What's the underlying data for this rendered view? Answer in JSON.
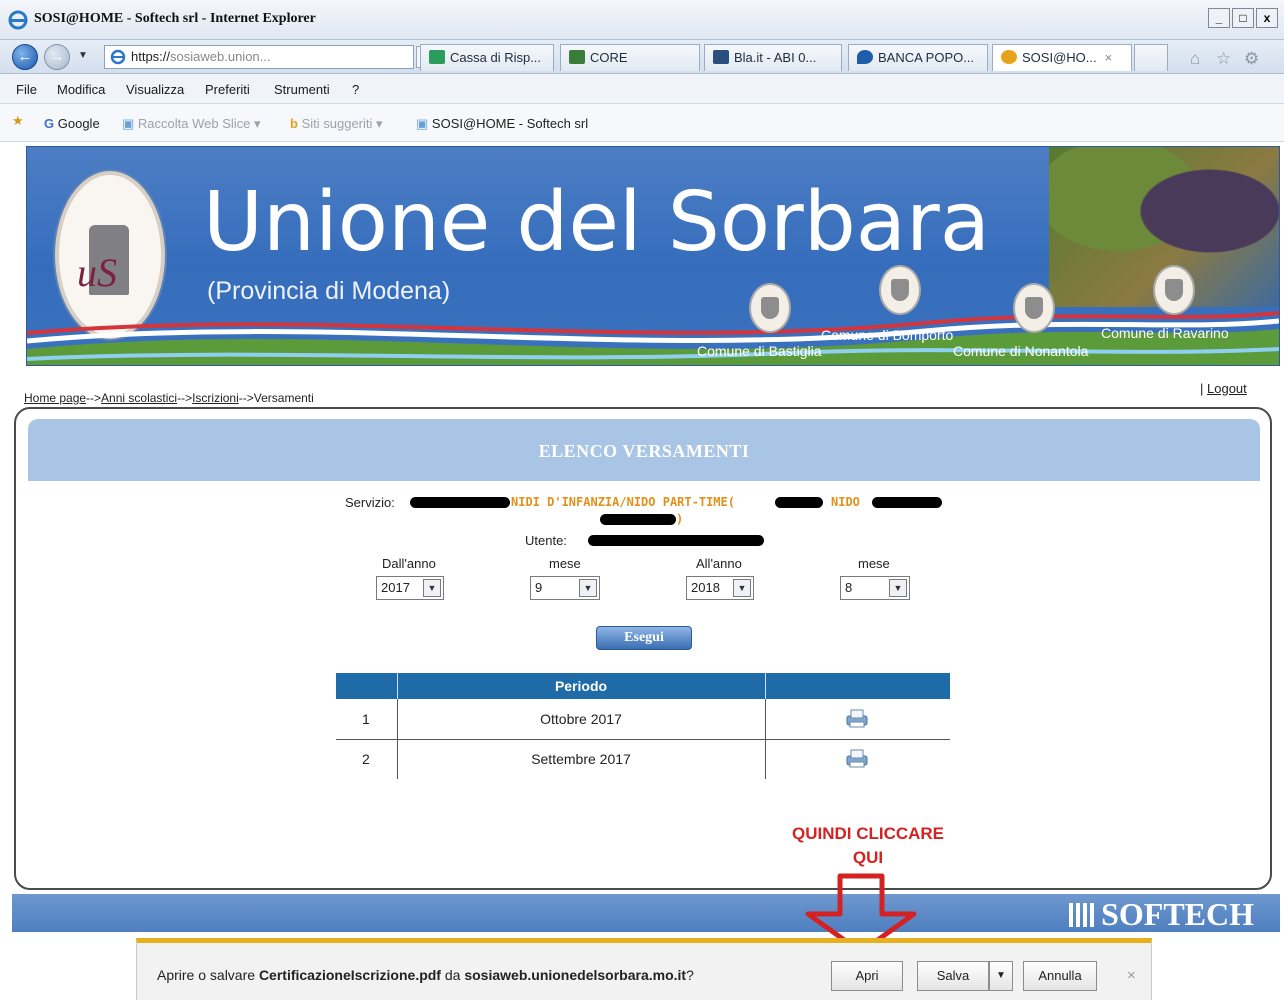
{
  "window": {
    "title": "SOSI@HOME - Softech srl - Internet Explorer",
    "controls": [
      "_",
      "□",
      "x"
    ]
  },
  "nav": {
    "address_host": "https://",
    "address_rest": "sosiaweb.union...",
    "tabs": [
      {
        "label": "Cassa di Risp...",
        "icon_color": "#2c9c5a"
      },
      {
        "label": "CORE",
        "icon_color": "#3a7d3a"
      },
      {
        "label": "Bla.it - ABI 0...",
        "icon_color": "#2a4f7f"
      },
      {
        "label": "BANCA POPO...",
        "icon_color": "#1e5da8"
      },
      {
        "label": "SOSI@HO...",
        "icon_color": "#e6a21a"
      }
    ],
    "tab_close": "×"
  },
  "menu": [
    "File",
    "Modifica",
    "Visualizza",
    "Preferiti",
    "Strumenti",
    "?"
  ],
  "favorites": {
    "google": "Google",
    "web_slice": "Raccolta Web Slice ▾",
    "suggested": "Siti suggeriti ▾",
    "page": "SOSI@HOME - Softech srl"
  },
  "banner": {
    "title": "Unione del Sorbara",
    "subtitle": "(Provincia di Modena)",
    "comuni": [
      "Comune di Bastiglia",
      "Comune di Bomporto",
      "Comune di Nonantola",
      "Comune di Ravarino"
    ]
  },
  "breadcrumb": {
    "home": "Home page",
    "sep": "-->",
    "anni": "Anni scolastici",
    "iscrizioni": "Iscrizioni",
    "current": "Versamenti"
  },
  "logout": {
    "bar": "|",
    "label": "Logout"
  },
  "panel": {
    "title": "ELENCO VERSAMENTI",
    "servizio_label": "Servizio:",
    "servizio_value": "NIDI D'INFANZIA/NIDO PART-TIME(",
    "servizio_value2": "NIDO",
    "servizio_tail": ")",
    "utente_label": "Utente:",
    "from_year_label": "Dall'anno",
    "from_month_label": "mese",
    "to_year_label": "All'anno",
    "to_month_label": "mese",
    "from_year": "2017",
    "from_month": "9",
    "to_year": "2018",
    "to_month": "8",
    "run_button": "Esegui",
    "table": {
      "header": "Periodo",
      "rows": [
        {
          "n": "1",
          "period": "Ottobre 2017"
        },
        {
          "n": "2",
          "period": "Settembre 2017"
        }
      ]
    }
  },
  "annotation": {
    "line1": "QUINDI  CLICCARE",
    "line2": "QUI"
  },
  "footer": {
    "brand": "SOFTECH"
  },
  "download": {
    "prefix": "Aprire o salvare ",
    "file": "CertificazioneIscrizione.pdf",
    "middle": " da ",
    "host": "sosiaweb.unionedelsorbara.mo.it",
    "suffix": "?",
    "open": "Apri",
    "save": "Salva",
    "cancel": "Annulla",
    "close": "×"
  },
  "colors": {
    "banner_blue": "#3a6fbd",
    "header_blue": "#1e6ba8",
    "annotation_red": "#d42222",
    "service_orange": "#e2911b",
    "notify_yellow": "#e6b01e"
  }
}
